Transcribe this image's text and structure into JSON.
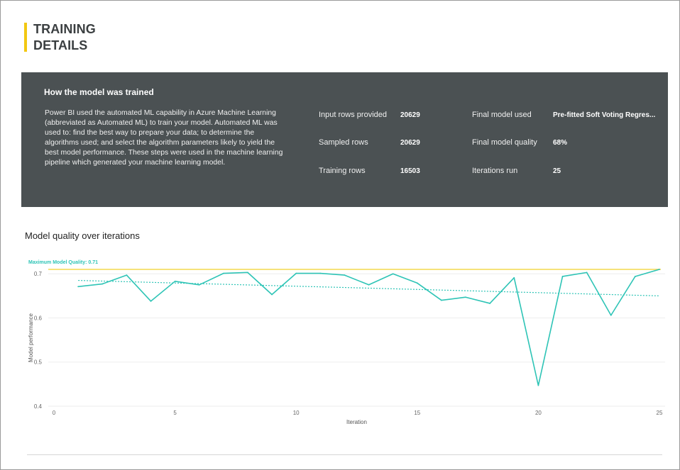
{
  "page": {
    "title_line1": "TRAINING",
    "title_line2": "DETAILS"
  },
  "panel": {
    "heading": "How the model was trained",
    "description": "Power BI used the automated ML capability in Azure Machine Learning (abbreviated as Automated ML) to train your model. Automated ML was used to: find the best way to prepare your data; to determine the algorithms used; and select the algorithm parameters likely to yield the best model performance. These steps were used in the machine learning pipeline which generated your machine learning model.",
    "stats_left": [
      {
        "label": "Input rows provided",
        "value": "20629"
      },
      {
        "label": "Sampled rows",
        "value": "20629"
      },
      {
        "label": "Training rows",
        "value": "16503"
      }
    ],
    "stats_right": [
      {
        "label": "Final model used",
        "value": "Pre-fitted Soft Voting Regres..."
      },
      {
        "label": "Final model quality",
        "value": "68%"
      },
      {
        "label": "Iterations run",
        "value": "25"
      }
    ]
  },
  "chart_section": {
    "title": "Model quality over iterations"
  },
  "chart_data": {
    "type": "line",
    "title": "Model quality over iterations",
    "xlabel": "Iteration",
    "ylabel": "Model performance",
    "xlim": [
      0,
      25
    ],
    "ylim": [
      0.4,
      0.71
    ],
    "x_ticks": [
      0,
      5,
      10,
      15,
      20,
      25
    ],
    "y_ticks": [
      0.4,
      0.5,
      0.6,
      0.7
    ],
    "y_tick_labels": [
      "0.4",
      "0.5",
      "0.6",
      "0.7"
    ],
    "grid": true,
    "series": [
      {
        "x": [
          1,
          2,
          3,
          4,
          5,
          6,
          7,
          8,
          9,
          10,
          11,
          12,
          13,
          14,
          15,
          16,
          17,
          18,
          19,
          20,
          21,
          22,
          23,
          24,
          25
        ],
        "values": [
          0.671,
          0.677,
          0.697,
          0.638,
          0.683,
          0.675,
          0.701,
          0.703,
          0.653,
          0.701,
          0.701,
          0.697,
          0.675,
          0.7,
          0.679,
          0.64,
          0.647,
          0.633,
          0.691,
          0.447,
          0.694,
          0.703,
          0.606,
          0.694,
          0.71
        ],
        "color": "#2ec4b6"
      }
    ],
    "trendline": {
      "x": [
        1,
        25
      ],
      "values": [
        0.685,
        0.65
      ],
      "color": "#2ec4b6",
      "style": "dotted"
    },
    "reference_line": {
      "value": 0.71,
      "label": "Maximum Model Quality: 0.71",
      "color": "#f6e27a",
      "label_color": "#2ec4b6"
    }
  },
  "colors": {
    "accent": "#f2c811",
    "panel_bg": "#4b5153",
    "series": "#2ec4b6"
  }
}
